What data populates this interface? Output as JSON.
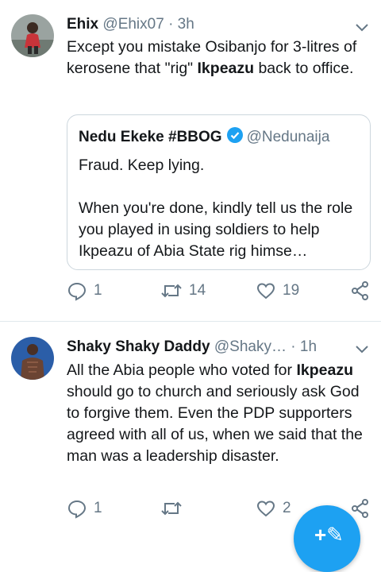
{
  "tweets": [
    {
      "name": "Ehix",
      "handle": "@Ehix07",
      "time": "· 3h",
      "text_parts": [
        {
          "t": "Except you mistake Osibanjo for 3-litres of kerosene that \"rig\" ",
          "b": false
        },
        {
          "t": "Ikpeazu",
          "b": true
        },
        {
          "t": " back to office.",
          "b": false
        }
      ],
      "quote": {
        "name": "Nedu Ekeke #BBOG",
        "handle": "@Nedunaija",
        "line1": "Fraud. Keep lying.",
        "line2": "When you're done, kindly tell us the role you played in using soldiers to help Ikpeazu of Abia State rig himse…"
      },
      "replies": "1",
      "retweets": "14",
      "likes": "19"
    },
    {
      "name": "Shaky Shaky Daddy",
      "handle": "@Shaky…",
      "time": "· 1h",
      "text_parts": [
        {
          "t": "All the Abia people who voted for ",
          "b": false
        },
        {
          "t": "Ikpeazu",
          "b": true
        },
        {
          "t": " should go to church and seriously ask God to forgive them. Even the PDP supporters agreed with all of us, when we said that the man was a leadership disaster.",
          "b": false
        }
      ],
      "replies": "1",
      "retweets": "",
      "likes": "2"
    }
  ],
  "colors": {
    "accent": "#1da1f2",
    "muted": "#657786",
    "border": "#ccd6dd"
  },
  "icons": [
    "chevron-down-icon",
    "reply-icon",
    "retweet-icon",
    "like-icon",
    "share-icon",
    "verified-icon",
    "compose-icon"
  ]
}
